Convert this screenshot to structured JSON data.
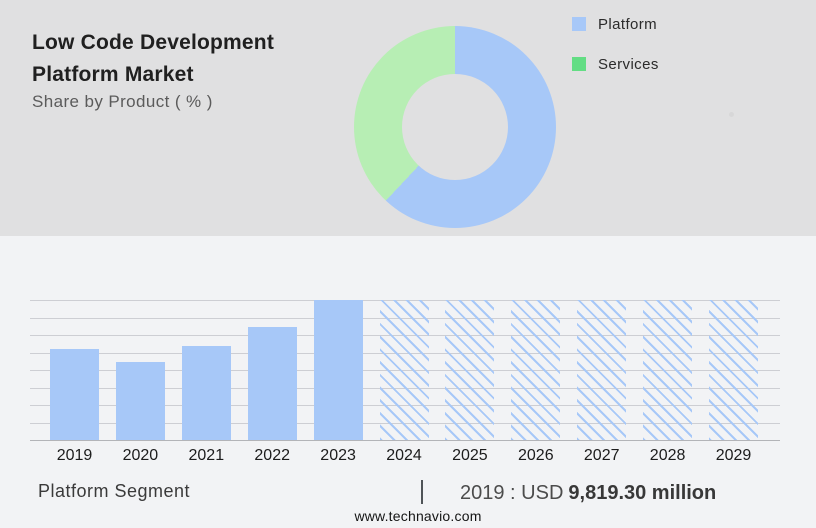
{
  "page": {
    "top_background": "#e0e0e1",
    "bottom_background": "#f2f3f5"
  },
  "header": {
    "title_line1": "Low Code Development",
    "title_line2": "Platform Market",
    "subtitle": "Share by Product ( % )"
  },
  "legend": {
    "items": [
      {
        "label": "Platform",
        "color": "#a7c8f8"
      },
      {
        "label": "Services",
        "color": "#63dd84"
      }
    ]
  },
  "footer": {
    "segment_label": "Platform Segment",
    "separator": "|",
    "value_prefix": "2019 : USD",
    "value_bold": "9,819.30 million",
    "website": "www.technavio.com"
  },
  "chart_data": [
    {
      "type": "pie",
      "subtype": "donut",
      "title": "Share by Product ( % )",
      "labels": [
        "Platform",
        "Services"
      ],
      "values": [
        62,
        38
      ],
      "colors": [
        "#a7c8f8",
        "#b7eeb4"
      ],
      "start_angle_deg": 0,
      "direction": "clockwise",
      "legend_position": "top-right",
      "hole_ratio": 0.52
    },
    {
      "type": "bar",
      "title": "Platform Segment",
      "categories": [
        "2019",
        "2020",
        "2021",
        "2022",
        "2023",
        "2024",
        "2025",
        "2026",
        "2027",
        "2028",
        "2029"
      ],
      "values_percent_of_max": [
        65,
        56,
        67,
        81,
        100,
        100,
        100,
        100,
        100,
        100,
        100
      ],
      "styles": [
        "solid",
        "solid",
        "solid",
        "solid",
        "solid",
        "hatched",
        "hatched",
        "hatched",
        "hatched",
        "hatched",
        "hatched"
      ],
      "hatched_meaning": "forecast years",
      "bar_color": "#a7c8f8",
      "grid": true,
      "gridline_count": 8,
      "known_value": {
        "year": "2019",
        "text": "2019 : USD 9,819.30 million"
      },
      "xlabel": "",
      "ylabel": ""
    }
  ]
}
